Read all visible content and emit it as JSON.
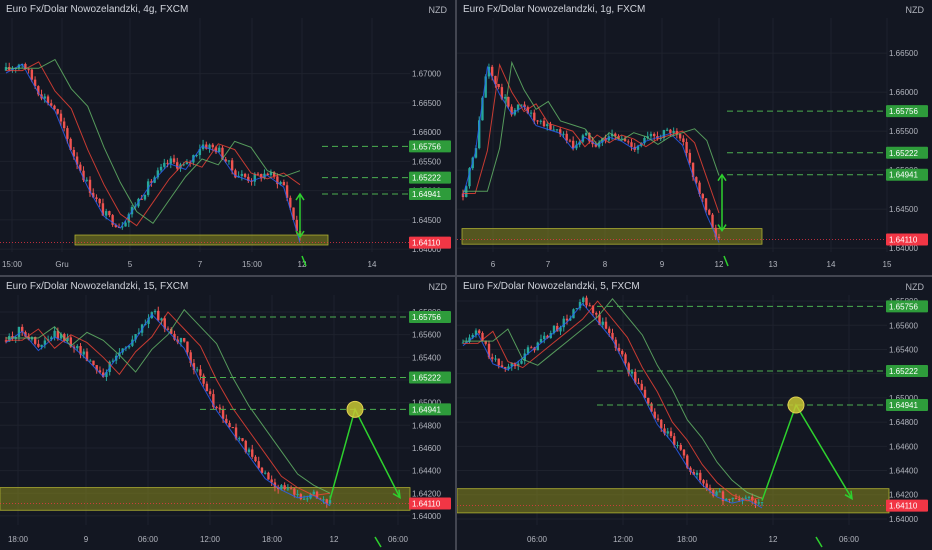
{
  "panels": [
    {
      "id": "4h",
      "title": "Euro Fx/Dolar Nowozelandzki, 4g, FXCM",
      "currency": "NZD",
      "x_ticks": [
        "15:00",
        "Gru",
        "5",
        "7",
        "15:00",
        "12",
        "14"
      ],
      "chart_data": {
        "type": "candlestick",
        "title": "Euro Fx/Dolar Nowozelandzki, 4g, FXCM",
        "ylabel": "NZD",
        "ylim": [
          1.6395,
          1.6795
        ],
        "y_ticks": [
          1.67,
          1.665,
          1.66,
          1.655,
          1.65,
          1.645,
          1.64
        ],
        "series": [
          {
            "values": [
              1.6705,
              1.672,
              1.667,
              1.664,
              1.657,
              1.651,
              1.646,
              1.644,
              1.648,
              1.652,
              1.655,
              1.654,
              1.658,
              1.657,
              1.653,
              1.652,
              1.653,
              1.651,
              1.6415
            ]
          }
        ],
        "levels": [
          {
            "value": 1.65756,
            "label": "1.65756",
            "color": "#4caf50"
          },
          {
            "value": 1.65222,
            "label": "1.65222",
            "color": "#4caf50"
          },
          {
            "value": 1.64941,
            "label": "1.64941",
            "color": "#4caf50"
          }
        ],
        "current_price": {
          "value": 1.6411,
          "label": "1.64110",
          "color": "#f23645"
        },
        "support_zone": [
          1.6407,
          1.6424
        ]
      }
    },
    {
      "id": "1h",
      "title": "Euro Fx/Dolar Nowozelandzki, 1g, FXCM",
      "currency": "NZD",
      "x_ticks": [
        "6",
        "7",
        "8",
        "9",
        "12",
        "13",
        "14",
        "15"
      ],
      "chart_data": {
        "type": "candlestick",
        "title": "Euro Fx/Dolar Nowozelandzki, 1g, FXCM",
        "ylabel": "NZD",
        "ylim": [
          1.6395,
          1.6695
        ],
        "y_ticks": [
          1.665,
          1.66,
          1.655,
          1.65,
          1.645,
          1.64
        ],
        "series": [
          {
            "values": [
              1.647,
              1.6525,
              1.6635,
              1.66,
              1.6575,
              1.6585,
              1.656,
              1.6555,
              1.655,
              1.653,
              1.6545,
              1.6535,
              1.6545,
              1.654,
              1.653,
              1.654,
              1.6545,
              1.655,
              1.6535,
              1.649,
              1.6445,
              1.641
            ]
          }
        ],
        "levels": [
          {
            "value": 1.65756,
            "label": "1.65756",
            "color": "#4caf50"
          },
          {
            "value": 1.65222,
            "label": "1.65222",
            "color": "#4caf50"
          },
          {
            "value": 1.64941,
            "label": "1.64941",
            "color": "#4caf50"
          }
        ],
        "current_price": {
          "value": 1.6411,
          "label": "1.64110",
          "color": "#f23645"
        },
        "support_zone": [
          1.6405,
          1.6425
        ]
      }
    },
    {
      "id": "15m",
      "title": "Euro Fx/Dolar Nowozelandzki, 15, FXCM",
      "currency": "NZD",
      "x_ticks": [
        "18:00",
        "9",
        "06:00",
        "12:00",
        "18:00",
        "12",
        "06:00"
      ],
      "chart_data": {
        "type": "candlestick",
        "title": "Euro Fx/Dolar Nowozelandzki, 15, FXCM",
        "ylabel": "NZD",
        "ylim": [
          1.6392,
          1.6595
        ],
        "y_ticks": [
          1.658,
          1.656,
          1.654,
          1.652,
          1.65,
          1.648,
          1.646,
          1.644,
          1.642,
          1.64
        ],
        "series": [
          {
            "values": [
              1.6555,
              1.6565,
              1.6548,
              1.656,
              1.6553,
              1.654,
              1.6525,
              1.6545,
              1.6558,
              1.658,
              1.6565,
              1.655,
              1.652,
              1.6495,
              1.6475,
              1.6455,
              1.6435,
              1.6425,
              1.6418,
              1.642,
              1.6411
            ]
          }
        ],
        "levels": [
          {
            "value": 1.65756,
            "label": "1.65756",
            "color": "#4caf50"
          },
          {
            "value": 1.65222,
            "label": "1.65222",
            "color": "#4caf50"
          },
          {
            "value": 1.64941,
            "label": "1.64941",
            "color": "#4caf50"
          }
        ],
        "current_price": {
          "value": 1.6411,
          "label": "1.64110",
          "color": "#f23645"
        },
        "support_zone": [
          1.6405,
          1.6425
        ]
      }
    },
    {
      "id": "5m",
      "title": "Euro Fx/Dolar Nowozelandzki, 5, FXCM",
      "currency": "NZD",
      "x_ticks": [
        "06:00",
        "12:00",
        "18:00",
        "12",
        "06:00"
      ],
      "chart_data": {
        "type": "candlestick",
        "title": "Euro Fx/Dolar Nowozelandzki, 5, FXCM",
        "ylabel": "NZD",
        "ylim": [
          1.6395,
          1.6585
        ],
        "y_ticks": [
          1.658,
          1.656,
          1.654,
          1.652,
          1.65,
          1.648,
          1.646,
          1.644,
          1.642,
          1.64
        ],
        "series": [
          {
            "values": [
              1.6545,
              1.6555,
              1.653,
              1.6525,
              1.6535,
              1.6545,
              1.6555,
              1.6565,
              1.658,
              1.6565,
              1.655,
              1.6525,
              1.6505,
              1.648,
              1.6465,
              1.6445,
              1.643,
              1.642,
              1.6415,
              1.6418,
              1.6411
            ]
          }
        ],
        "levels": [
          {
            "value": 1.65756,
            "label": "1.65756",
            "color": "#4caf50"
          },
          {
            "value": 1.65222,
            "label": "1.65222",
            "color": "#4caf50"
          },
          {
            "value": 1.64941,
            "label": "1.64941",
            "color": "#4caf50"
          }
        ],
        "current_price": {
          "value": 1.6411,
          "label": "1.64110",
          "color": "#f23645"
        },
        "support_zone": [
          1.6405,
          1.6425
        ]
      }
    }
  ],
  "colors": {
    "background": "#131722",
    "up": "#26a69a",
    "down": "#ef5350",
    "level_line": "#4caf50",
    "zone_fill": "#8a8a1e",
    "arrow": "#2ed12e",
    "circle": "#c8c832"
  }
}
